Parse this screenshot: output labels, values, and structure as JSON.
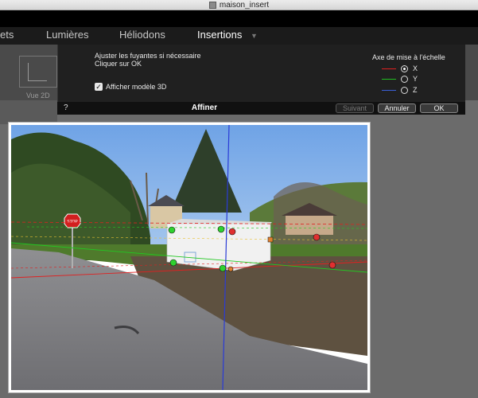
{
  "window": {
    "title": "maison_insert"
  },
  "tabs": [
    {
      "label": "ets"
    },
    {
      "label": "Lumières"
    },
    {
      "label": "Héliodons"
    },
    {
      "label": "Insertions"
    }
  ],
  "toolbar": {
    "vue2d_label": "Vue 2D"
  },
  "panel": {
    "instruction_1": "Ajuster les fuyantes si nécessaire",
    "instruction_2": "Cliquer sur OK",
    "checkbox_label": "Afficher modèle 3D",
    "checkbox_checked": true,
    "axis_title": "Axe de mise à l'échelle",
    "axes": [
      {
        "label": "X",
        "color": "#e02020",
        "selected": true
      },
      {
        "label": "Y",
        "color": "#20c020",
        "selected": false
      },
      {
        "label": "Z",
        "color": "#3a60d8",
        "selected": false
      }
    ]
  },
  "footer": {
    "help_label": "?",
    "title": "Affiner",
    "suivant_label": "Suivant",
    "annuler_label": "Annuler",
    "ok_label": "OK"
  },
  "photo": {
    "stop_sign_text": "STOP"
  }
}
